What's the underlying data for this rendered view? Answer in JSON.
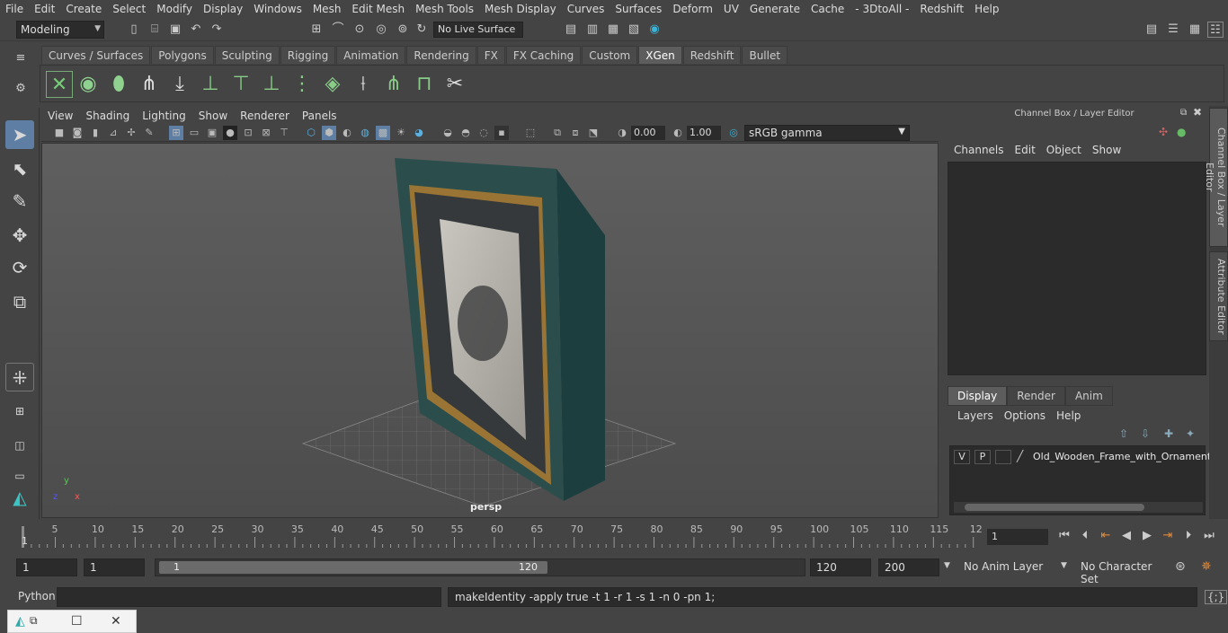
{
  "menubar": [
    "File",
    "Edit",
    "Create",
    "Select",
    "Modify",
    "Display",
    "Windows",
    "Mesh",
    "Edit Mesh",
    "Mesh Tools",
    "Mesh Display",
    "Curves",
    "Surfaces",
    "Deform",
    "UV",
    "Generate",
    "Cache",
    "- 3DtoAll -",
    "Redshift",
    "Help"
  ],
  "status": {
    "mode": "Modeling",
    "live_surface": "No Live Surface"
  },
  "shelf": {
    "tabs": [
      "Curves / Surfaces",
      "Polygons",
      "Sculpting",
      "Rigging",
      "Animation",
      "Rendering",
      "FX",
      "FX Caching",
      "Custom",
      "XGen",
      "Redshift",
      "Bullet"
    ],
    "active": "XGen"
  },
  "viewport": {
    "menu": [
      "View",
      "Shading",
      "Lighting",
      "Show",
      "Renderer",
      "Panels"
    ],
    "exposure": "0.00",
    "gamma": "1.00",
    "color_space": "sRGB gamma",
    "camera": "persp"
  },
  "channel_box": {
    "title": "Channel Box / Layer Editor",
    "menu": [
      "Channels",
      "Edit",
      "Object",
      "Show"
    ],
    "layer_tabs": [
      "Display",
      "Render",
      "Anim"
    ],
    "active_layer_tab": "Display",
    "layer_menu": [
      "Layers",
      "Options",
      "Help"
    ],
    "layer": {
      "v": "V",
      "p": "P",
      "name": "Old_Wooden_Frame_with_Ornament"
    }
  },
  "side_tabs": [
    "Channel Box / Layer Editor",
    "Attribute Editor"
  ],
  "timeline": {
    "tick_labels": [
      "5",
      "10",
      "15",
      "20",
      "25",
      "30",
      "35",
      "40",
      "45",
      "50",
      "55",
      "60",
      "65",
      "70",
      "75",
      "80",
      "85",
      "90",
      "95",
      "100",
      "105",
      "110",
      "115",
      "12"
    ],
    "start_label": "1",
    "current_frame": "1"
  },
  "range": {
    "start": "1",
    "playback_start": "1",
    "slider_start": "1",
    "slider_end": "120",
    "playback_end": "120",
    "end": "200",
    "anim_layer": "No Anim Layer",
    "character_set": "No Character Set"
  },
  "command": {
    "language": "Python",
    "output": "makeIdentity -apply true -t 1 -r 1 -s 1 -n 0 -pn 1;"
  }
}
